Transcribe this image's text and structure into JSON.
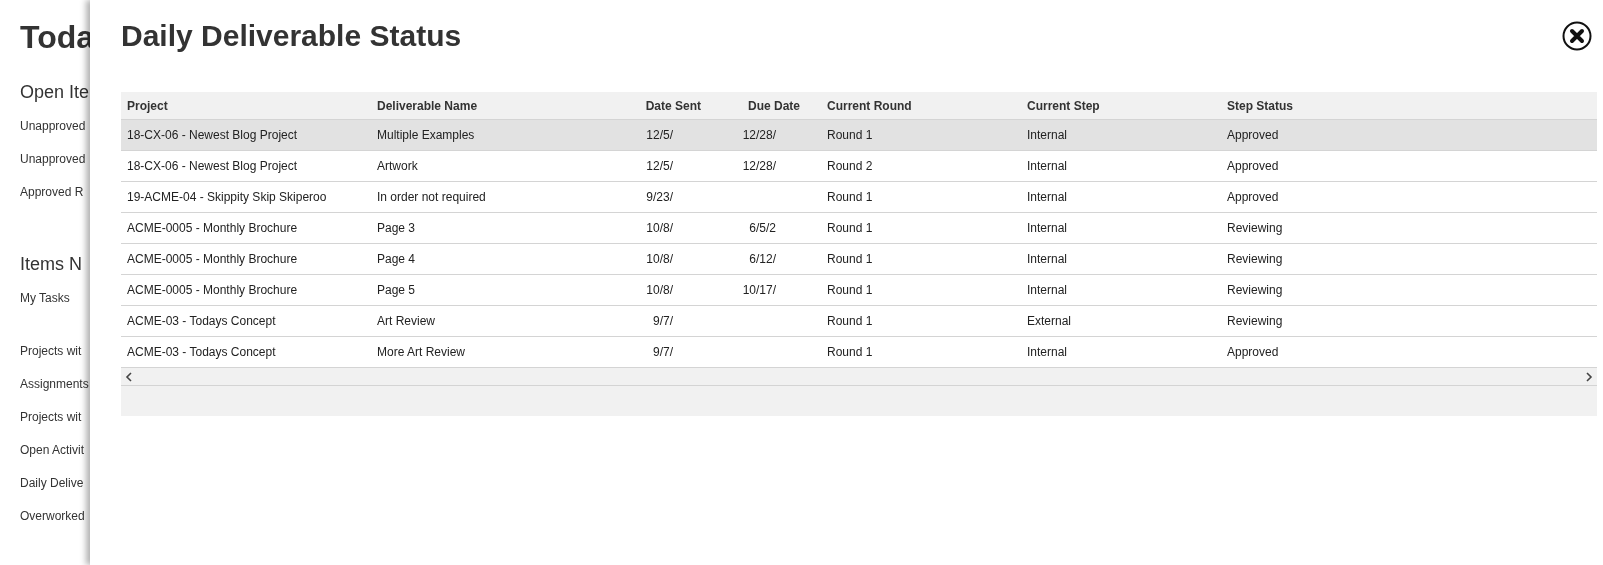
{
  "page": {
    "title": "Toda",
    "sections": [
      {
        "heading": "Open Ite",
        "links": [
          "Unapproved",
          "Unapproved",
          "Approved R"
        ]
      },
      {
        "heading": "Items N",
        "links": [
          "My Tasks"
        ]
      },
      {
        "links": [
          "Projects wit",
          "Assignments",
          "Projects wit",
          "Open Activit",
          "Daily Delive",
          "Overworked"
        ]
      }
    ]
  },
  "dialog": {
    "title": "Daily Deliverable Status",
    "table": {
      "columns": [
        "Project",
        "Deliverable Name",
        "Date Sent",
        "Due Date",
        "Current Round",
        "Current Step",
        "Step Status"
      ],
      "rows": [
        {
          "selected": true,
          "cells": [
            "18-CX-06 - Newest Blog Project",
            "Multiple Examples",
            "12/5/",
            "12/28/",
            "Round 1",
            "Internal",
            "Approved"
          ]
        },
        {
          "selected": false,
          "cells": [
            "18-CX-06 - Newest Blog Project",
            "Artwork",
            "12/5/",
            "12/28/",
            "Round 2",
            "Internal",
            "Approved"
          ]
        },
        {
          "selected": false,
          "cells": [
            "19-ACME-04 - Skippity Skip Skiperoo",
            "In order not required",
            "9/23/",
            "",
            "Round 1",
            "Internal",
            "Approved"
          ]
        },
        {
          "selected": false,
          "cells": [
            "ACME-0005 - Monthly Brochure",
            "Page 3",
            "10/8/",
            "6/5/2",
            "Round 1",
            "Internal",
            "Reviewing"
          ]
        },
        {
          "selected": false,
          "cells": [
            "ACME-0005 - Monthly Brochure",
            "Page 4",
            "10/8/",
            "6/12/",
            "Round 1",
            "Internal",
            "Reviewing"
          ]
        },
        {
          "selected": false,
          "cells": [
            "ACME-0005 - Monthly Brochure",
            "Page 5",
            "10/8/",
            "10/17/",
            "Round 1",
            "Internal",
            "Reviewing"
          ]
        },
        {
          "selected": false,
          "cells": [
            "ACME-03 - Todays Concept",
            "Art Review",
            "9/7/",
            "",
            "Round 1",
            "External",
            "Reviewing"
          ]
        },
        {
          "selected": false,
          "cells": [
            "ACME-03 - Todays Concept",
            "More Art Review",
            "9/7/",
            "",
            "Round 1",
            "Internal",
            "Approved"
          ]
        }
      ]
    }
  }
}
